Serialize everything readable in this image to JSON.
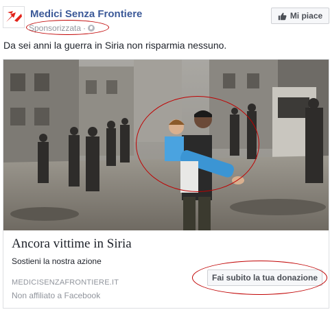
{
  "header": {
    "page_name": "Medici Senza Frontiere",
    "sponsored_label": "Sponsorizzata",
    "separator": "·",
    "privacy_icon": "globe-icon",
    "like_button_label": "Mi piace",
    "like_icon": "thumbs-up-icon"
  },
  "post": {
    "text": "Da sei anni la guerra in Siria non risparmia nessuno."
  },
  "attachment": {
    "headline": "Ancora vittime in Siria",
    "description": "Sostieni la nostra azione",
    "domain": "MEDICISENZAFRONTIERE.IT",
    "disclaimer": "Non affiliato a Facebook",
    "cta_label": "Fai subito la tua donazione"
  },
  "colors": {
    "brand_red": "#e2231a",
    "facebook_blue": "#3b5998",
    "annotation_red": "#c00000",
    "muted_text": "#90949c"
  }
}
